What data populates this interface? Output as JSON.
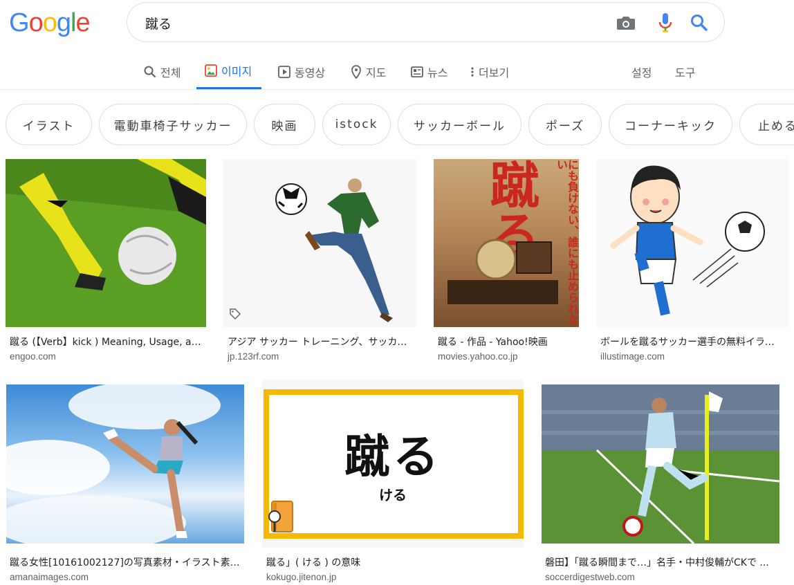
{
  "logo": {
    "letters": [
      "G",
      "o",
      "o",
      "g",
      "l",
      "e"
    ],
    "colors": [
      "#4285F4",
      "#EA4335",
      "#FBBC05",
      "#4285F4",
      "#34A853",
      "#EA4335"
    ]
  },
  "search": {
    "query": "蹴る"
  },
  "tabs": [
    {
      "label": "전체",
      "icon": "search-icon"
    },
    {
      "label": "이미지",
      "icon": "image-icon",
      "active": true
    },
    {
      "label": "동영상",
      "icon": "video-icon"
    },
    {
      "label": "지도",
      "icon": "map-pin-icon"
    },
    {
      "label": "뉴스",
      "icon": "news-icon"
    },
    {
      "label": "더보기",
      "icon": "more-vert-icon"
    }
  ],
  "tools": {
    "settings": "설정",
    "tools": "도구"
  },
  "chips": [
    "イラスト",
    "電動車椅子サッカー",
    "映画",
    "istock",
    "サッカーボール",
    "ポーズ",
    "コーナーキック",
    "止める"
  ],
  "results": [
    {
      "caption": "蹴る (【Verb】kick ) Meaning, Usage, and Readings ...",
      "source": "engoo.com"
    },
    {
      "caption": "アジア サッカー トレーニング、サッカー ...",
      "source": "jp.123rf.com"
    },
    {
      "caption": "蹴る - 作品 - Yahoo!映画",
      "source": "movies.yahoo.co.jp",
      "poster_title": "蹴る",
      "poster_tagline": "にも負けない、誰にも止められない"
    },
    {
      "caption": "ボールを蹴るサッカー選手の無料イラスト ...",
      "source": "illustimage.com"
    },
    {
      "caption": "蹴る女性[10161002127]の写真素材・イラスト素材 ...",
      "source": "amanaimages.com"
    },
    {
      "caption": "蹴る」( ける ) の意味",
      "source": "kokugo.jitenon.jp",
      "card_word": "蹴る",
      "card_reading": "ける"
    },
    {
      "caption": "磐田】「蹴る瞬間まで…」名手・中村俊輔がCKで ...",
      "source": "soccerdigestweb.com"
    }
  ],
  "colors": {
    "accent": "#1a73e8",
    "mic_blue": "#4285F4",
    "mic_red": "#EA4335",
    "border": "#dfe1e5"
  }
}
